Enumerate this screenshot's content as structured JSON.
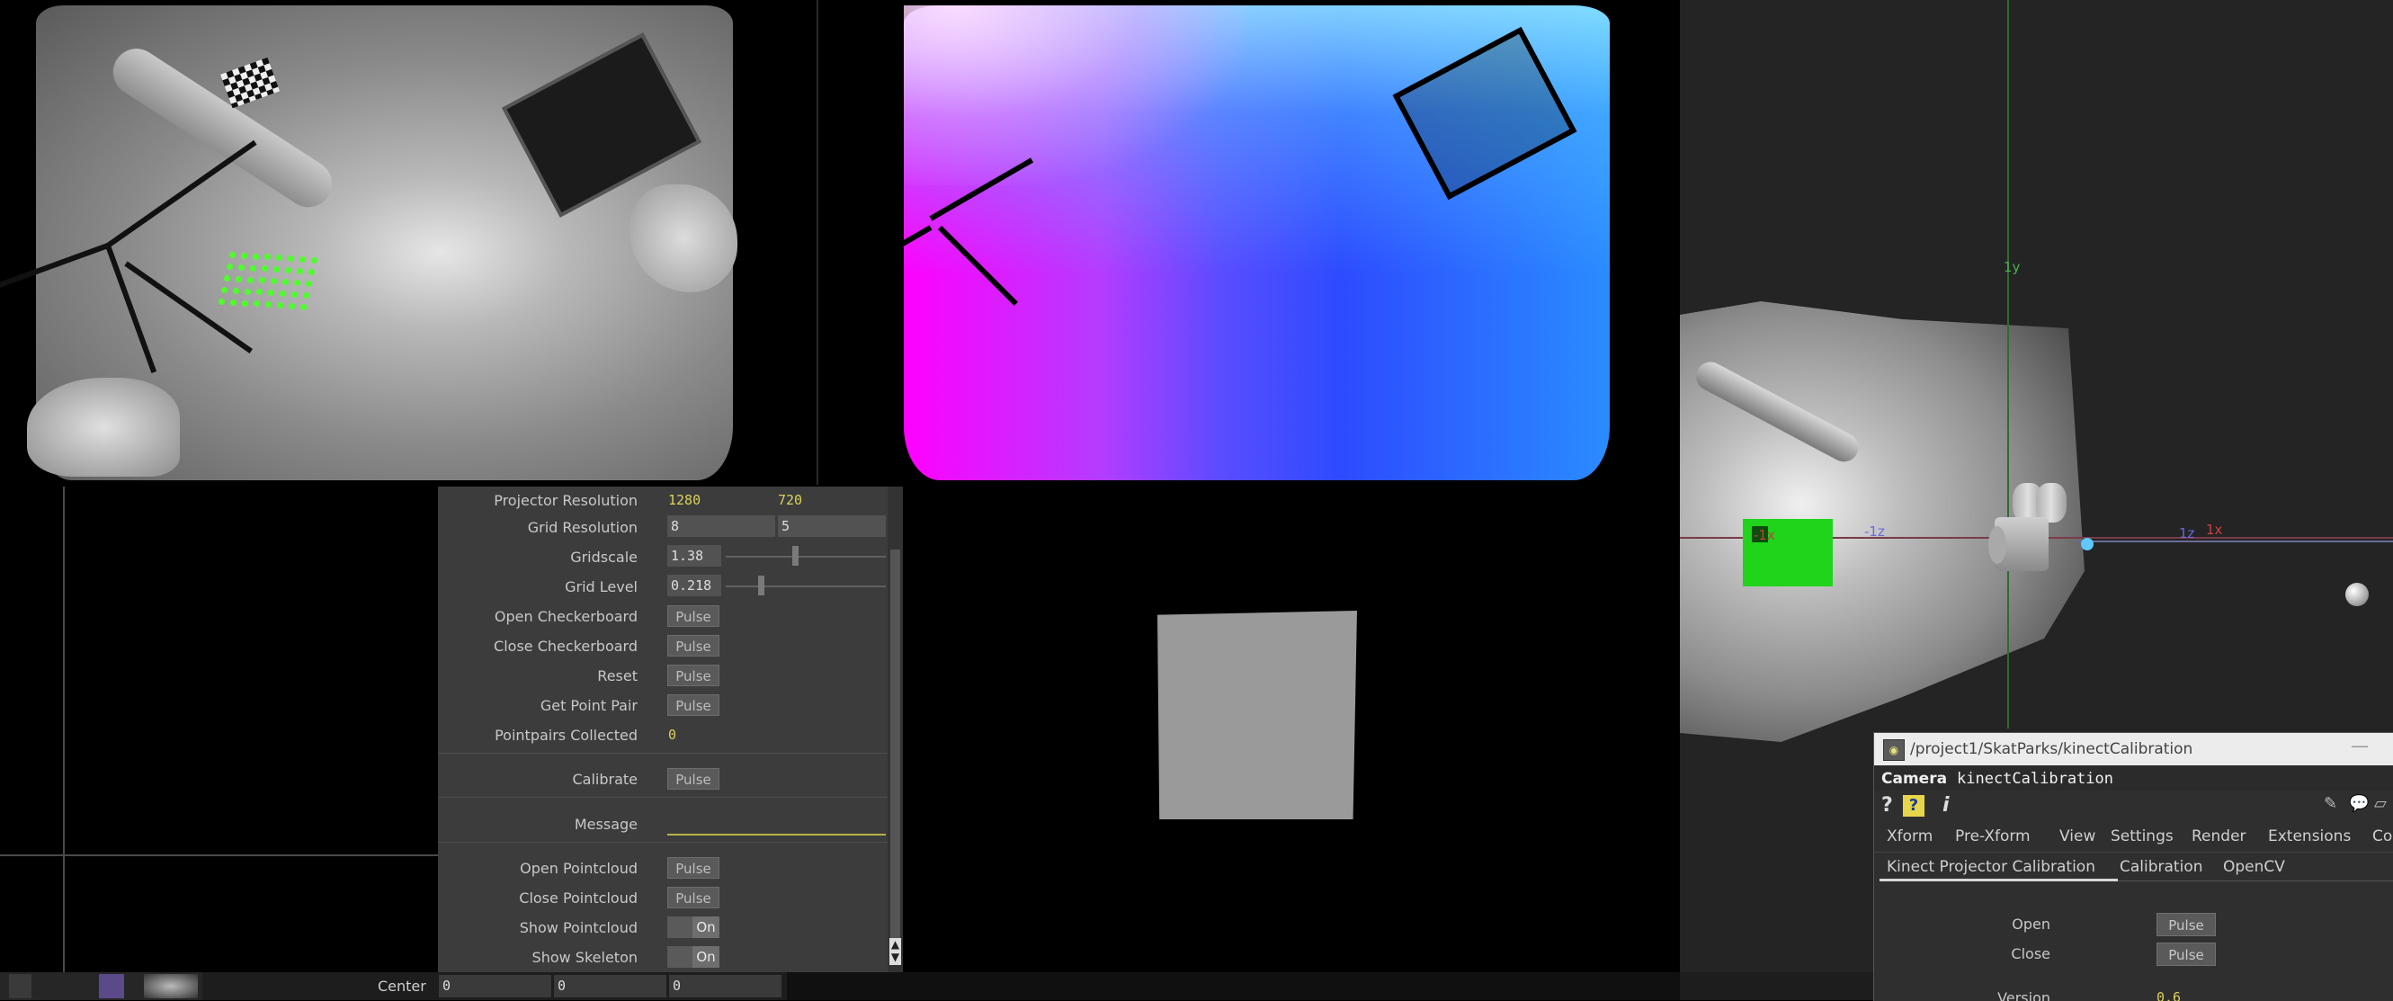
{
  "params": {
    "projector_resolution": {
      "label": "Projector Resolution",
      "w": "1280",
      "h": "720"
    },
    "grid_resolution": {
      "label": "Grid Resolution",
      "a": "8",
      "b": "5"
    },
    "gridscale": {
      "label": "Gridscale",
      "value": "1.38",
      "level": 0.43
    },
    "grid_level": {
      "label": "Grid Level",
      "value": "0.218",
      "level": 0.22
    },
    "open_checkerboard": {
      "label": "Open Checkerboard",
      "button": "Pulse"
    },
    "close_checkerboard": {
      "label": "Close Checkerboard",
      "button": "Pulse"
    },
    "reset": {
      "label": "Reset",
      "button": "Pulse"
    },
    "get_point_pair": {
      "label": "Get Point Pair",
      "button": "Pulse"
    },
    "pointpairs_collected": {
      "label": "Pointpairs Collected",
      "value": "0"
    },
    "calibrate": {
      "label": "Calibrate",
      "button": "Pulse"
    },
    "message": {
      "label": "Message",
      "value": ""
    },
    "open_pointcloud": {
      "label": "Open Pointcloud",
      "button": "Pulse"
    },
    "close_pointcloud": {
      "label": "Close Pointcloud",
      "button": "Pulse"
    },
    "show_pointcloud": {
      "label": "Show Pointcloud",
      "toggle": "On"
    },
    "show_skeleton": {
      "label": "Show Skeleton",
      "toggle": "On"
    }
  },
  "scene": {
    "axis_labels": {
      "y": "1y",
      "z_neg": "-1z",
      "x_neg": "-1x",
      "z": "1z",
      "x": "1x"
    }
  },
  "camera_window": {
    "path": "/project1/SkatParks/kinectCalibration",
    "minimize": "—",
    "op_type": "Camera",
    "op_name": "kinectCalibration",
    "icons": {
      "help": "?",
      "python_help": "?",
      "info": "i"
    },
    "tabs": [
      "Xform",
      "Pre-Xform",
      "View",
      "Settings",
      "Render",
      "Extensions",
      "Co"
    ],
    "subtabs": [
      "Kinect Projector Calibration",
      "Calibration",
      "OpenCV"
    ],
    "rows": {
      "open": {
        "label": "Open",
        "button": "Pulse"
      },
      "close": {
        "label": "Close",
        "button": "Pulse"
      },
      "version": {
        "label": "Version",
        "value": "0.6"
      }
    }
  },
  "bottom": {
    "center_label": "Center",
    "center_values": [
      "0",
      "0",
      "0"
    ]
  },
  "colors": {
    "accent_value": "#d9d25a",
    "grid_dots": "#4dff2a",
    "green_quad": "#1fd41a",
    "panel_bg": "#3c3c3c"
  }
}
